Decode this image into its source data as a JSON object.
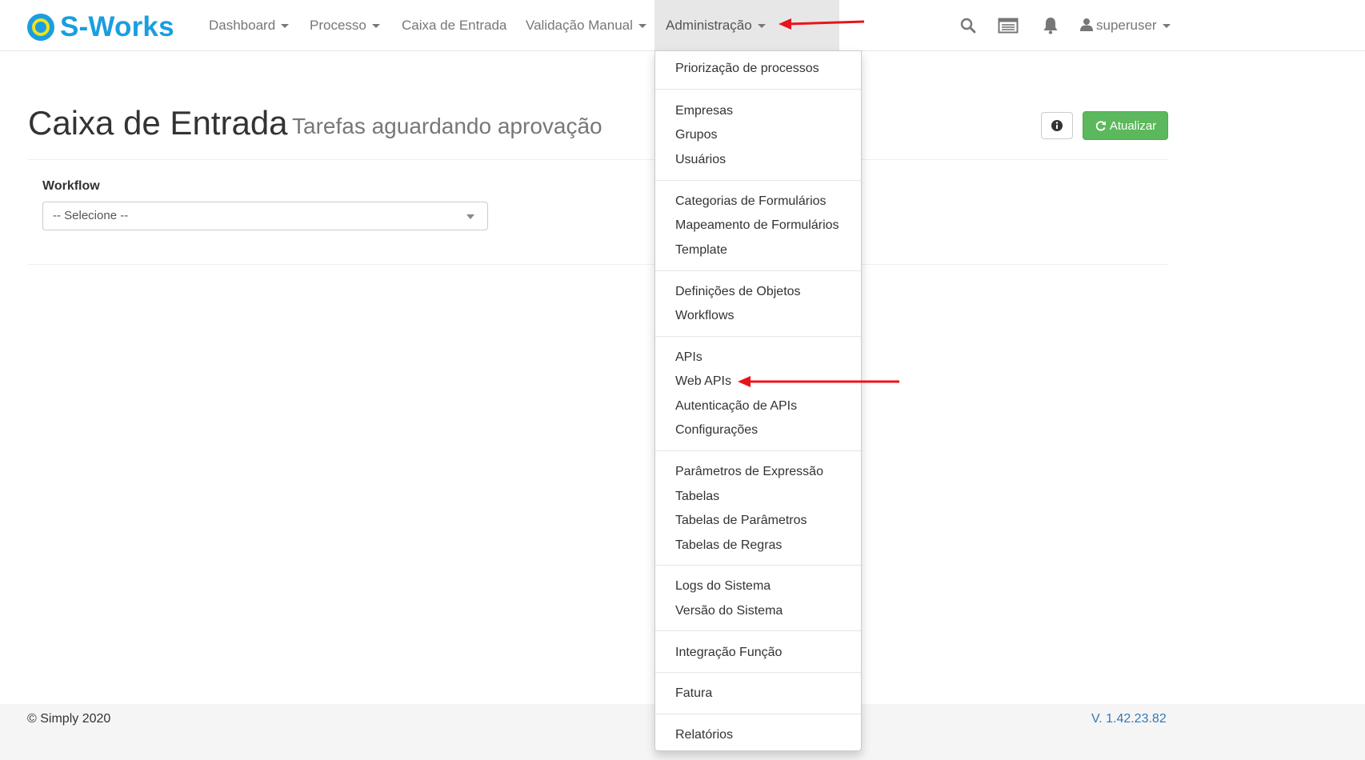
{
  "brand": {
    "name": "S-Works"
  },
  "nav": {
    "items": [
      {
        "label": "Dashboard"
      },
      {
        "label": "Processo"
      },
      {
        "label": "Caixa de Entrada"
      },
      {
        "label": "Validação Manual"
      },
      {
        "label": "Administração"
      }
    ],
    "user": "superuser",
    "icons": [
      "search-icon",
      "list-icon",
      "bell-icon",
      "user-icon"
    ]
  },
  "page": {
    "title": "Caixa de Entrada",
    "subtitle": "Tarefas aguardando aprovação",
    "refresh_label": "Atualizar"
  },
  "filter": {
    "label": "Workflow",
    "selected": "-- Selecione --"
  },
  "admin_menu": {
    "groups": [
      [
        "Priorização de processos"
      ],
      [
        "Empresas",
        "Grupos",
        "Usuários"
      ],
      [
        "Categorias de Formulários",
        "Mapeamento de Formulários",
        "Template"
      ],
      [
        "Definições de Objetos",
        "Workflows"
      ],
      [
        "APIs",
        "Web APIs",
        "Autenticação de APIs",
        "Configurações"
      ],
      [
        "Parâmetros de Expressão",
        "Tabelas",
        "Tabelas de Parâmetros",
        "Tabelas de Regras"
      ],
      [
        "Logs do Sistema",
        "Versão do Sistema"
      ],
      [
        "Integração Função"
      ],
      [
        "Fatura"
      ],
      [
        "Relatórios"
      ]
    ]
  },
  "footer": {
    "copyright": "© Simply 2020",
    "version": "V. 1.42.23.82"
  },
  "colors": {
    "brand": "#1a9ee0",
    "success": "#5cb85c",
    "annotation_arrow": "#e8141b",
    "link": "#337ab7"
  }
}
